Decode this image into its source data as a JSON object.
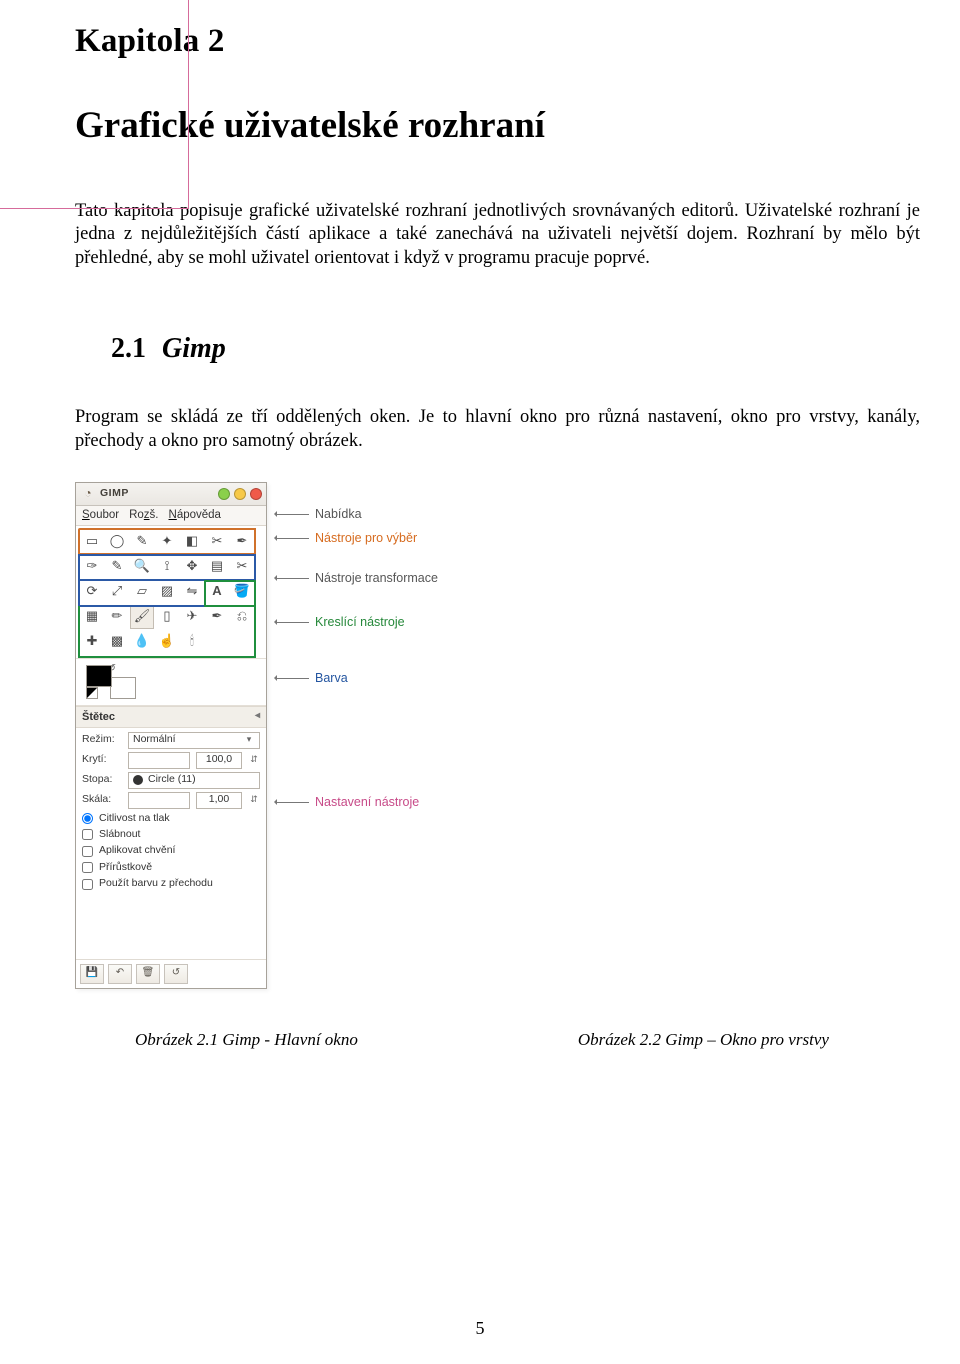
{
  "chapter_heading": "Kapitola 2",
  "title": "Grafické uživatelské rozhraní",
  "paragraph_intro": "Tato kapitola popisuje grafické uživatelské rozhraní jednotlivých srovnávaných editorů. Uživatelské rozhraní je jedna z nejdůležitějších částí aplikace a také zanechává na uživateli největší dojem. Rozhraní by mělo být přehledné, aby se mohl uživatel orientovat i když v programu pracuje poprvé.",
  "section_number": "2.1",
  "section_name": "Gimp",
  "paragraph_section": "Program se skládá ze tří oddělených oken. Je to hlavní okno pro různá nastavení, okno pro vrstvy, kanály, přechody a okno pro samotný obrázek.",
  "toolbox": {
    "window_title": "GIMP",
    "menu": {
      "file": "Soubor",
      "ext": "Rozš.",
      "help": "Nápověda"
    },
    "opts_title": "Štětec",
    "rows": {
      "mode_label": "Režim:",
      "mode_value": "Normální",
      "opacity_label": "Krytí:",
      "opacity_value": "100,0",
      "brush_label": "Stopa:",
      "brush_value": "Circle (11)",
      "scale_label": "Skála:",
      "scale_value": "1,00"
    },
    "checks": {
      "c1": "Citlivost na tlak",
      "c2": "Slábnout",
      "c3": "Aplikovat chvění",
      "c4": "Přírůstkově",
      "c5": "Použít barvu z přechodu"
    }
  },
  "callouts": {
    "menu": "Nabídka",
    "selection": "Nástroje pro výběr",
    "transform": "Nástroje transformace",
    "draw": "Kreslící nástroje",
    "color": "Barva",
    "toolopts": "Nastavení nástroje"
  },
  "captions": {
    "left": "Obrázek 2.1 Gimp - Hlavní okno",
    "right": "Obrázek 2.2 Gimp – Okno pro vrstvy"
  },
  "page_number": "5"
}
